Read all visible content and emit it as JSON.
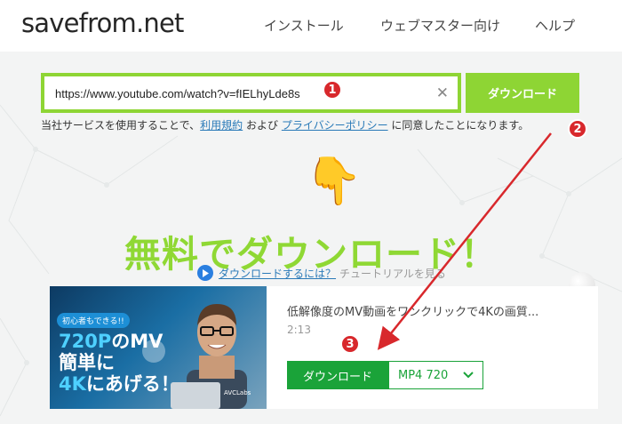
{
  "header": {
    "logo": "savefrom.net",
    "nav": [
      {
        "label": "インストール"
      },
      {
        "label": "ウェブマスター向け"
      },
      {
        "label": "ヘルプ"
      }
    ]
  },
  "search": {
    "url_value": "https://www.youtube.com/watch?v=fIELhyLde8s",
    "clear_glyph": "✕",
    "download_label": "ダウンロード"
  },
  "terms": {
    "prefix": "当社サービスを使用することで、",
    "link1": "利用規約",
    "middle": " および ",
    "link2": "プライバシーポリシー",
    "suffix": " に同意したことになります。"
  },
  "hand_icon": "👇",
  "headline": "無料でダウンロード！",
  "howto": {
    "link": "ダウンロードするには？",
    "suffix": "チュートリアルを見る"
  },
  "result": {
    "thumbnail": {
      "badge": "初心者もできる!!",
      "line1_hi": "720P",
      "line1_rest": "のMV",
      "line2": "簡単に",
      "line3_hi": "4K",
      "line3_rest": "にあげる！",
      "brand": "AVCLabs"
    },
    "title": "低解像度のMV動画をワンクリックで4Kの画質...",
    "duration": "2:13",
    "download_label": "ダウンロード",
    "format": "MP4  720"
  },
  "annotations": [
    "1",
    "2",
    "3"
  ],
  "colors": {
    "brand_green": "#8ed534",
    "headline_green": "#8fd834",
    "download_green": "#1aa339",
    "annotation_red": "#d8282c",
    "link_blue": "#2a7ab8"
  }
}
